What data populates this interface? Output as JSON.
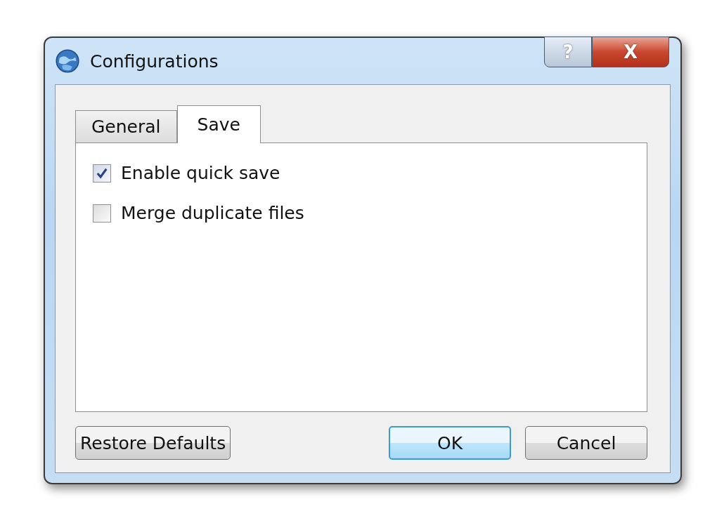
{
  "window": {
    "title": "Configurations",
    "title_buttons": [
      {
        "kind": "help",
        "label": "?"
      },
      {
        "kind": "close",
        "label": "X"
      }
    ]
  },
  "tabs": [
    {
      "label": "General",
      "selected": false
    },
    {
      "label": "Save",
      "selected": true
    }
  ],
  "options": [
    {
      "label": "Enable quick save",
      "checked": true
    },
    {
      "label": "Merge duplicate files",
      "checked": false
    }
  ],
  "footer": {
    "left_buttons": [
      {
        "label": "Restore Defaults",
        "default": false
      }
    ],
    "right_buttons": [
      {
        "label": "OK",
        "default": true
      },
      {
        "label": "Cancel",
        "default": false
      }
    ]
  }
}
